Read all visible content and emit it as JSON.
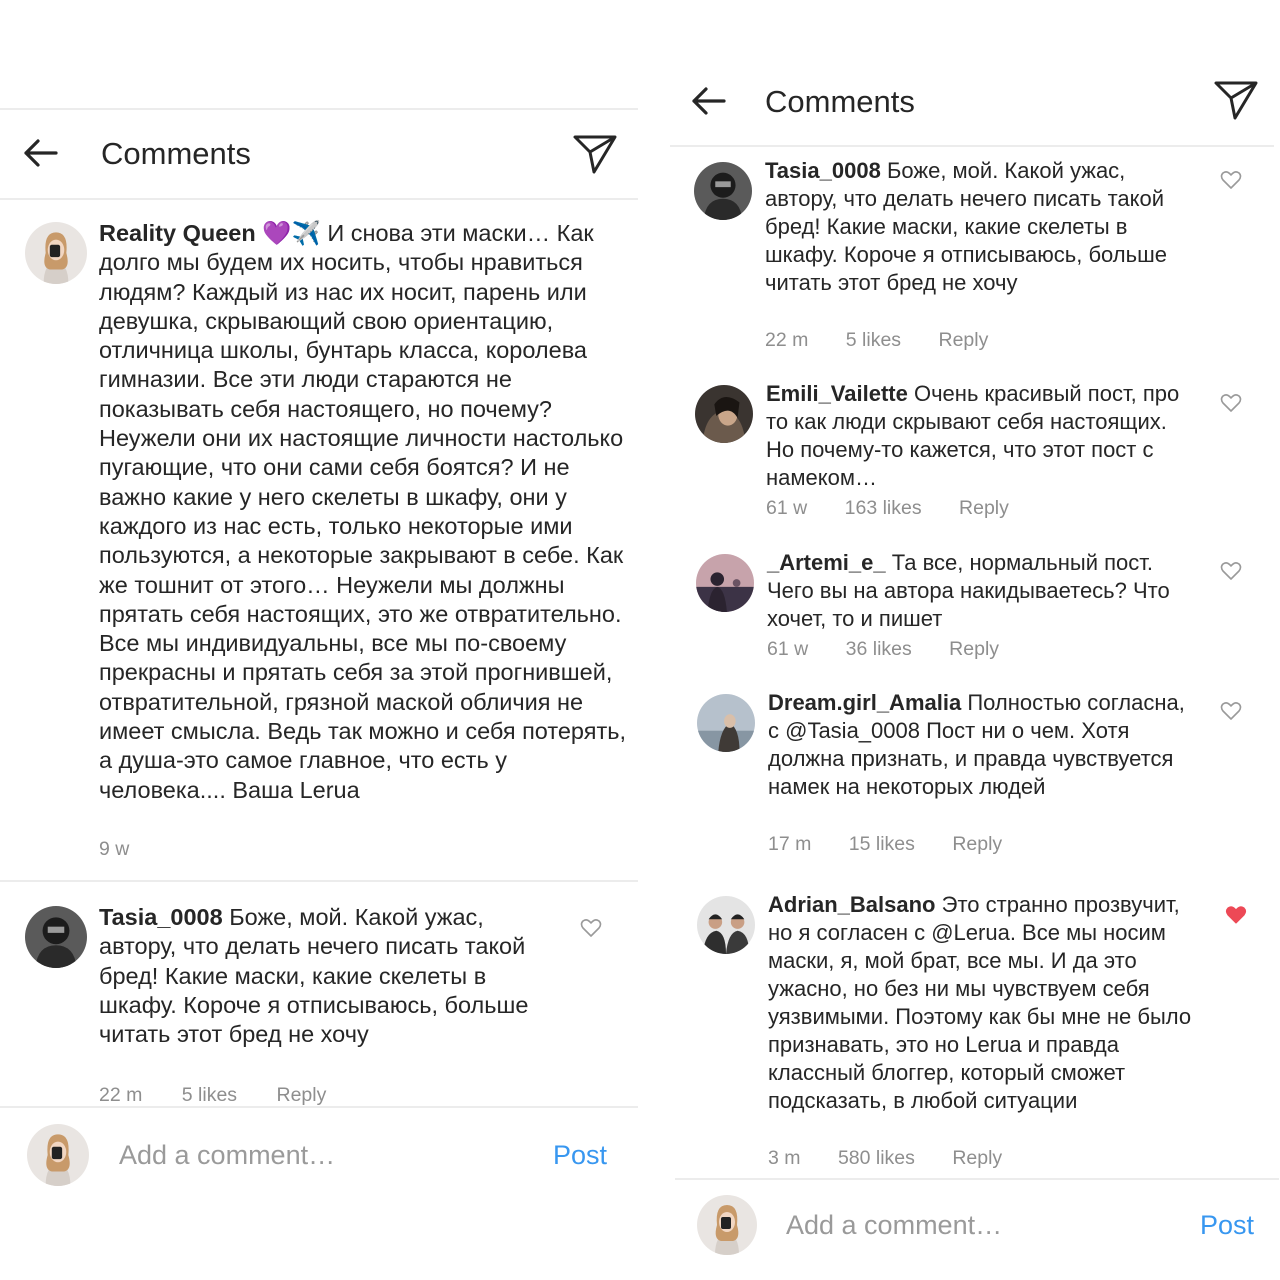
{
  "left_screen": {
    "header": {
      "title": "Comments"
    },
    "caption": {
      "username": "Reality Queen",
      "emoji_heart": "💜",
      "emoji_plane": "✈️",
      "text": "И снова эти маски… Как долго мы будем их носить, чтобы нравиться людям? Каждый из нас их носит, парень или девушка, скрывающий свою ориентацию, отличница школы, бунтарь класса, королева гимназии. Все эти люди стараются не показывать себя настоящего, но почему? Неужели они их настоящие личности настолько пугающие, что они сами себя боятся? И не важно какие у него скелеты в шкафу, они у каждого из нас есть, только некоторые ими пользуются, а некоторые закрывают в себе. Как же тошнит от этого… Неужели мы должны прятать себя настоящих, это же отвратительно. Все мы индивидуальны, все мы по-своему прекрасны и прятать себя за этой прогнившей, отвратительной, грязной маской обличия не имеет смысла. Ведь так можно и себя потерять, а душа-это самое главное, что есть у человека.... Ваша Lerua",
      "time": "9 w"
    },
    "comment": {
      "username": "Tasia_0008",
      "text": "Боже, мой. Какой ужас, автору, что делать нечего писать такой бред! Какие маски, какие скелеты в шкафу. Короче я отписываюсь, больше читать этот бред не хочу",
      "time": "22 m",
      "likes": "5 likes",
      "reply": "Reply"
    },
    "add_comment": {
      "placeholder": "Add a comment…",
      "post_label": "Post"
    }
  },
  "right_screen": {
    "header": {
      "title": "Comments"
    },
    "comments": [
      {
        "username": "Tasia_0008",
        "text": "Боже, мой. Какой ужас, автору, что делать нечего писать такой бред! Какие маски, какие скелеты в шкафу. Короче я отписываюсь, больше читать этот бред не хочу",
        "time": "22 m",
        "likes": "5 likes",
        "reply": "Reply",
        "liked": false
      },
      {
        "username": "Emili_Vailette",
        "text": "Очень красивый пост, про то как люди скрывают себя настоящих. Но почему-то кажется, что этот пост с намеком…",
        "time": "61 w",
        "likes": "163 likes",
        "reply": "Reply",
        "liked": false
      },
      {
        "username": "_Artemi_e_",
        "text": "Та все, нормальный пост. Чего вы на автора накидываетесь? Что хочет, то и пишет",
        "time": "61 w",
        "likes": "36 likes",
        "reply": "Reply",
        "liked": false
      },
      {
        "username": "Dream.girl_Amalia",
        "text": "Полностью согласна, с @Tasia_0008 Пост ни о чем. Хотя должна признать, и правда чувствуется намек на некоторых людей",
        "time": "17 m",
        "likes": "15 likes",
        "reply": "Reply",
        "liked": false
      },
      {
        "username": "Adrian_Balsano",
        "text": "Это странно прозвучит, но я согласен с @Lerua. Все мы носим маски, я, мой брат, все мы. И да это ужасно, но без ни мы чувствуем себя уязвимыми. Поэтому как бы мне не было признавать, это но Lerua и правда классный блоггер, который сможет подсказать, в любой ситуации",
        "time": "3 m",
        "likes": "580 likes",
        "reply": "Reply",
        "liked": true
      }
    ],
    "add_comment": {
      "placeholder": "Add a comment…",
      "post_label": "Post"
    }
  },
  "colors": {
    "text": "#262626",
    "meta": "#8e8e8e",
    "divider": "#ececec",
    "post_blue": "#3897f0",
    "liked_heart": "#ed4956"
  },
  "icons": {
    "back": "arrow-left-icon",
    "send": "paper-plane-icon",
    "like": "heart-outline-icon",
    "liked": "heart-filled-icon"
  }
}
